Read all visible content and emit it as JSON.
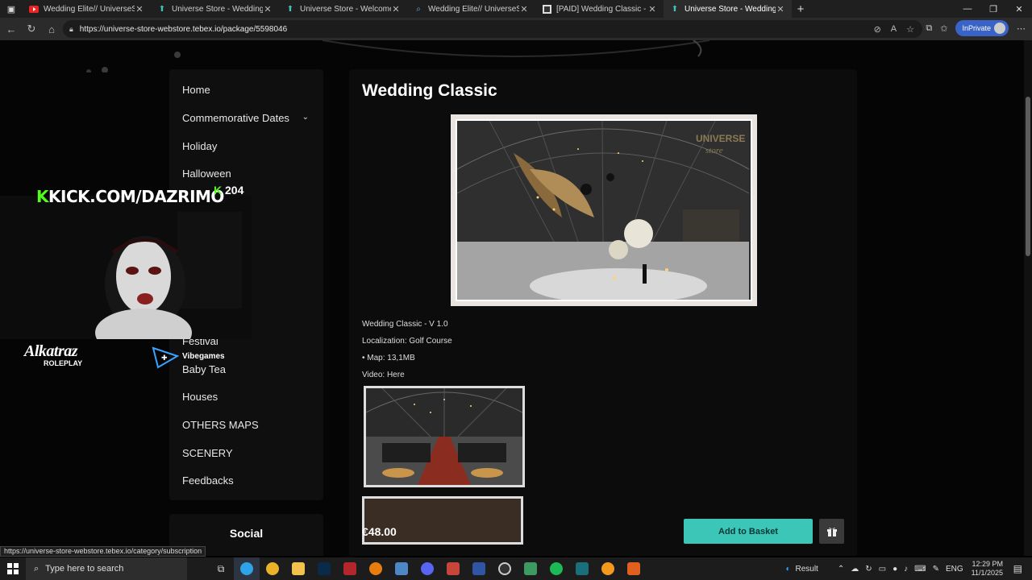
{
  "browser": {
    "tabs": [
      {
        "title": "Wedding Elite// UniverseStore //",
        "icon": "youtube-icon",
        "active": false
      },
      {
        "title": "Universe Store - Wedding",
        "icon": "tebex-icon",
        "active": false
      },
      {
        "title": "Universe Store - Welcome",
        "icon": "tebex-icon",
        "active": false
      },
      {
        "title": "Wedding Elite// UniverseStore //",
        "icon": "search-icon",
        "active": false
      },
      {
        "title": "[PAID] Wedding Classic - FIVE M",
        "icon": "forum-icon",
        "active": false
      },
      {
        "title": "Universe Store - Wedding Classic",
        "icon": "tebex-icon",
        "active": true
      }
    ],
    "url": "https://universe-store-webstore.tebex.io/package/5598046",
    "inprivate_label": "InPrivate",
    "status_url": "https://universe-store-webstore.tebex.io/category/subscription"
  },
  "sidebar": {
    "items": [
      {
        "label": "Home"
      },
      {
        "label": "Commemorative Dates"
      },
      {
        "label": "Holiday"
      },
      {
        "label": "Halloween"
      },
      {
        "label": "Festival"
      },
      {
        "label": "Baby Tea"
      },
      {
        "label": "Houses"
      },
      {
        "label": "OTHERS MAPS"
      },
      {
        "label": "SCENERY"
      },
      {
        "label": "Feedbacks"
      }
    ],
    "social_heading": "Social"
  },
  "product": {
    "title": "Wedding Classic",
    "description": [
      "Wedding Classic - V 1.0",
      "Localization: Golf Course",
      "• Map: 13,1MB",
      "Video: Here"
    ],
    "price": "€48.00",
    "add_to_basket_label": "Add to Basket",
    "watermark": "UNIVERSE store"
  },
  "overlay": {
    "kick_url": "KICK.COM/DAZRIMO",
    "viewer_count": "204",
    "logo_text": "Alkatraz",
    "logo_sub": "ROLEPLAY",
    "partner": "Vibegames"
  },
  "taskbar": {
    "search_placeholder": "Type here to search",
    "result_label": "Result",
    "lang": "ENG",
    "time": "12:29 PM",
    "date": "11/1/2025"
  },
  "colors": {
    "accent": "#3cc6b7",
    "kick_green": "#53fc18",
    "inprivate": "#3a63c7"
  }
}
